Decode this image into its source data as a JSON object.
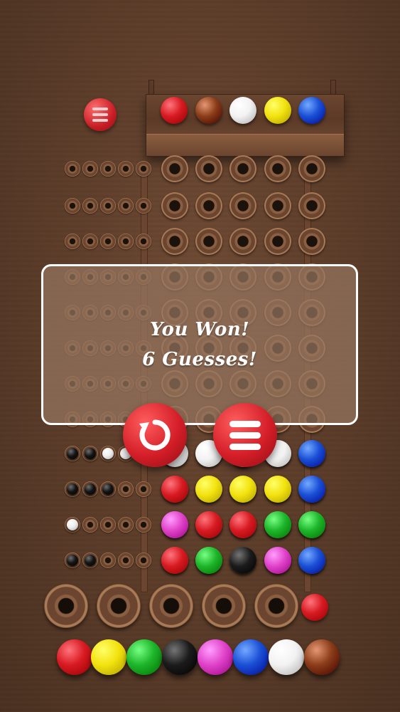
{
  "result": {
    "title": "You Won!",
    "guesses_text": "6 Guesses!"
  },
  "buttons": {
    "menu_small": "menu-icon",
    "restart": "restart-icon",
    "menu_large": "menu-icon"
  },
  "colors": {
    "red": "#d81a22",
    "brown": "#8a3d18",
    "white": "#f2f2f2",
    "yellow": "#f2e20e",
    "blue": "#1a4fd6",
    "green": "#1db52a",
    "black": "#1b1b1b",
    "magenta": "#e043c9",
    "key_black": "#151515",
    "key_white": "#eeeeee"
  },
  "secret_code": [
    "red",
    "brown",
    "white",
    "yellow",
    "blue"
  ],
  "guess_rows": [
    {
      "pegs": [
        "white",
        "white",
        "white",
        "white",
        "blue"
      ],
      "keys": [
        "black",
        "black",
        "white",
        "white"
      ]
    },
    {
      "pegs": [
        "red",
        "yellow",
        "yellow",
        "yellow",
        "blue"
      ],
      "keys": [
        "black",
        "black",
        "black"
      ]
    },
    {
      "pegs": [
        "magenta",
        "red",
        "red",
        "green",
        "green"
      ],
      "keys": [
        "white"
      ]
    },
    {
      "pegs": [
        "red",
        "green",
        "black",
        "magenta",
        "blue"
      ],
      "keys": [
        "black",
        "black"
      ]
    }
  ],
  "current_selection": "red",
  "palette": [
    "red",
    "yellow",
    "green",
    "black",
    "magenta",
    "blue",
    "white",
    "brown"
  ]
}
